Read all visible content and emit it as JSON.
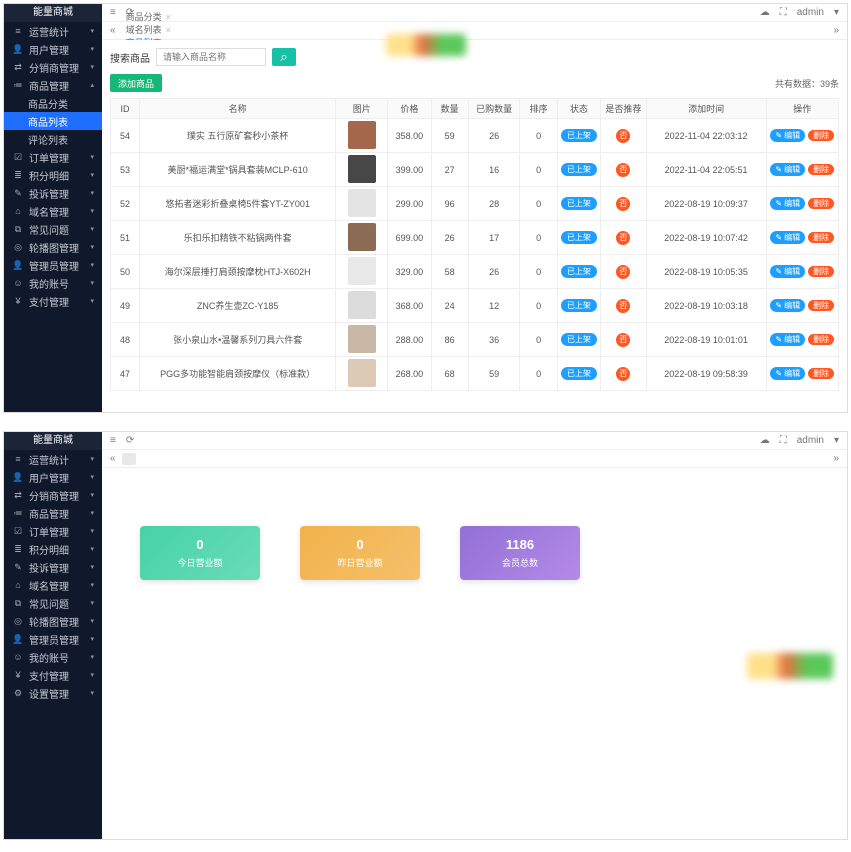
{
  "brand": "能量商城",
  "header": {
    "admin": "admin"
  },
  "sidebar_top": [
    {
      "icon": "≡",
      "label": "运营统计"
    },
    {
      "icon": "👤",
      "label": "用户管理"
    },
    {
      "icon": "⇄",
      "label": "分销商管理"
    },
    {
      "icon": "≔",
      "label": "商品管理",
      "expanded": true,
      "children": [
        {
          "label": "商品分类"
        },
        {
          "label": "商品列表",
          "active": true
        },
        {
          "label": "评论列表"
        }
      ]
    },
    {
      "icon": "☑",
      "label": "订单管理"
    },
    {
      "icon": "≣",
      "label": "积分明细"
    },
    {
      "icon": "✎",
      "label": "投诉管理"
    },
    {
      "icon": "⌂",
      "label": "域名管理"
    },
    {
      "icon": "⧉",
      "label": "常见问题"
    },
    {
      "icon": "◎",
      "label": "轮播图管理"
    },
    {
      "icon": "👤",
      "label": "管理员管理"
    },
    {
      "icon": "☺",
      "label": "我的账号"
    },
    {
      "icon": "¥",
      "label": "支付管理"
    }
  ],
  "sidebar_bottom": [
    {
      "icon": "≡",
      "label": "运营统计"
    },
    {
      "icon": "👤",
      "label": "用户管理"
    },
    {
      "icon": "⇄",
      "label": "分销商管理"
    },
    {
      "icon": "≔",
      "label": "商品管理"
    },
    {
      "icon": "☑",
      "label": "订单管理"
    },
    {
      "icon": "≣",
      "label": "积分明细"
    },
    {
      "icon": "✎",
      "label": "投诉管理"
    },
    {
      "icon": "⌂",
      "label": "域名管理"
    },
    {
      "icon": "⧉",
      "label": "常见问题"
    },
    {
      "icon": "◎",
      "label": "轮播图管理"
    },
    {
      "icon": "👤",
      "label": "管理员管理"
    },
    {
      "icon": "☺",
      "label": "我的账号"
    },
    {
      "icon": "¥",
      "label": "支付管理"
    },
    {
      "icon": "⚙",
      "label": "设置管理"
    }
  ],
  "tabs_top": [
    {
      "label": "商品分类"
    },
    {
      "label": "域名列表"
    },
    {
      "label": "商品列表",
      "active": true
    }
  ],
  "search": {
    "label": "搜索商品",
    "placeholder": "请输入商品名称"
  },
  "add_label": "添加商品",
  "total_label": "共有数据：39条",
  "columns": [
    "ID",
    "名称",
    "图片",
    "价格",
    "数量",
    "已购数量",
    "排序",
    "状态",
    "是否推荐",
    "添加时间",
    "操作"
  ],
  "status_text": "已上架",
  "rec_text": "否",
  "edit_text": "编辑",
  "del_text": "删除",
  "rows": [
    {
      "id": "54",
      "name": "璞实 五行原矿套秒小茶杯",
      "price": "358.00",
      "qty": "59",
      "sold": "26",
      "sort": "0",
      "time": "2022-11-04 22:03:12",
      "img": "#a5674b"
    },
    {
      "id": "53",
      "name": "美厨*福运满堂*锅具套装MCLP-610",
      "price": "399.00",
      "qty": "27",
      "sold": "16",
      "sort": "0",
      "time": "2022-11-04 22:05:51",
      "img": "#474747"
    },
    {
      "id": "52",
      "name": "悠拓者迷彩折叠桌椅5件套YT-ZY001",
      "price": "299.00",
      "qty": "96",
      "sold": "28",
      "sort": "0",
      "time": "2022-08-19 10:09:37",
      "img": "#e4e4e4"
    },
    {
      "id": "51",
      "name": "乐扣乐扣精铁不粘锅两件套",
      "price": "699.00",
      "qty": "26",
      "sold": "17",
      "sort": "0",
      "time": "2022-08-19 10:07:42",
      "img": "#8b6b54"
    },
    {
      "id": "50",
      "name": "海尔深层捶打肩颈按摩枕HTJ-X602H",
      "price": "329.00",
      "qty": "58",
      "sold": "26",
      "sort": "0",
      "time": "2022-08-19 10:05:35",
      "img": "#e8e8e8"
    },
    {
      "id": "49",
      "name": "ZNC养生壶ZC-Y185",
      "price": "368.00",
      "qty": "24",
      "sold": "12",
      "sort": "0",
      "time": "2022-08-19 10:03:18",
      "img": "#dcdcdc"
    },
    {
      "id": "48",
      "name": "张小泉山水•温馨系列刀具六件套",
      "price": "288.00",
      "qty": "86",
      "sold": "36",
      "sort": "0",
      "time": "2022-08-19 10:01:01",
      "img": "#c9b8a6"
    },
    {
      "id": "47",
      "name": "PGG多功能智能肩颈按摩仪（标准款）",
      "price": "268.00",
      "qty": "68",
      "sold": "59",
      "sort": "0",
      "time": "2022-08-19 09:58:39",
      "img": "#dcc9b6"
    }
  ],
  "dashboard": [
    {
      "value": "0",
      "label": "今日营业额",
      "cls": "c-green"
    },
    {
      "value": "0",
      "label": "昨日营业额",
      "cls": "c-orange"
    },
    {
      "value": "1186",
      "label": "会员总数",
      "cls": "c-purple"
    }
  ]
}
